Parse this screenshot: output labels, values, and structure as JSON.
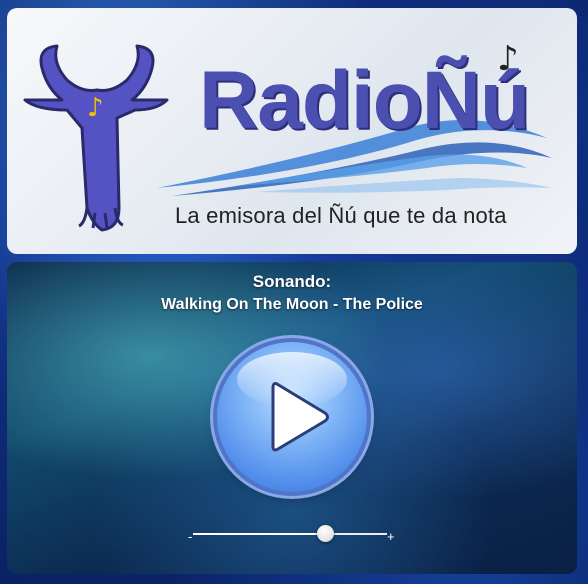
{
  "banner": {
    "brand": "RadioÑú",
    "tagline": "La emisora del Ñú que te da nota",
    "logo_icon": "bull-head-icon",
    "note_icon": "music-note-icon",
    "colors": {
      "brand": "#4a4fb0",
      "wave": "#3a7fd6"
    }
  },
  "player": {
    "now_playing_label": "Sonando:",
    "track": "Walking On The Moon - The Police",
    "play_icon": "play-icon",
    "volume": {
      "min_label": "-",
      "max_label": "+",
      "level": 0.68
    }
  }
}
